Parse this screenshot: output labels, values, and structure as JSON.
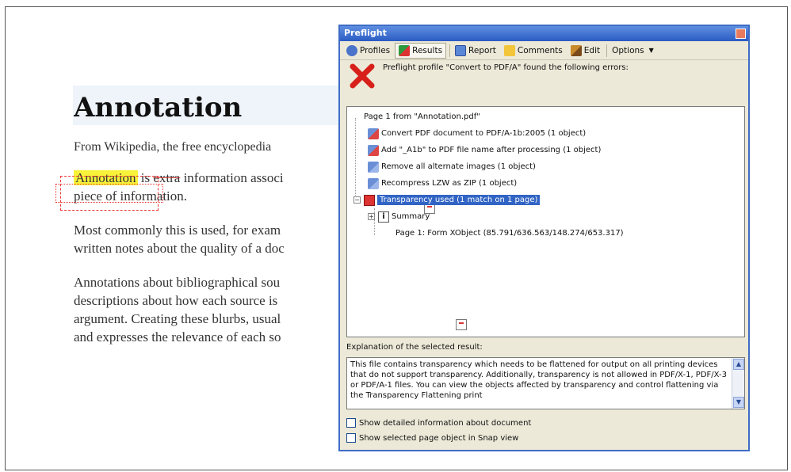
{
  "document": {
    "title": "Annotation",
    "subtitle": "From Wikipedia, the free encyclopedia",
    "p1_highlight": "Annotation",
    "p1_word": "is",
    "p1_strike": "extra",
    "p1_rest": "information associ",
    "p1_line2": "piece of information.",
    "p2_line1": "Most commonly this is used, for exam",
    "p2_line2": "written notes about the quality of a doc",
    "p3_line1": "Annotations about bibliographical sou",
    "p3_line2": "descriptions about how each source is",
    "p3_line3": "argument. Creating these blurbs, usual",
    "p3_line4": "and expresses the relevance of each so"
  },
  "panel": {
    "title": "Preflight",
    "toolbar": {
      "profiles": "Profiles",
      "results": "Results",
      "report": "Report",
      "comments": "Comments",
      "edit": "Edit",
      "options": "Options"
    },
    "error_message": "Preflight profile \"Convert to PDF/A\" found the following errors:",
    "tree": {
      "root": "Page 1 from \"Annotation.pdf\"",
      "items": [
        "Convert PDF document to PDF/A-1b:2005 (1 object)",
        "Add \"_A1b\" to PDF file name after processing (1 object)",
        "Remove all alternate images (1 object)",
        "Recompress LZW as ZIP (1 object)"
      ],
      "selected": "Transparency used (1 match on 1 page)",
      "summary": "Summary",
      "page_object": "Page 1: Form XObject (85.791/636.563/148.274/653.317)"
    },
    "explanation_label": "Explanation of the selected result:",
    "explanation_text": "This file contains transparency which needs to be flattened for output on all printing devices that do not support transparency. Additionally, transparency is not allowed in PDF/X-1, PDF/X-3 or PDF/A-1 files. You can view the objects affected by transparency and control flattening via the Transparency Flattening print",
    "checkbox_detailed": "Show detailed information about document",
    "checkbox_snap": "Show selected page object in Snap view"
  }
}
